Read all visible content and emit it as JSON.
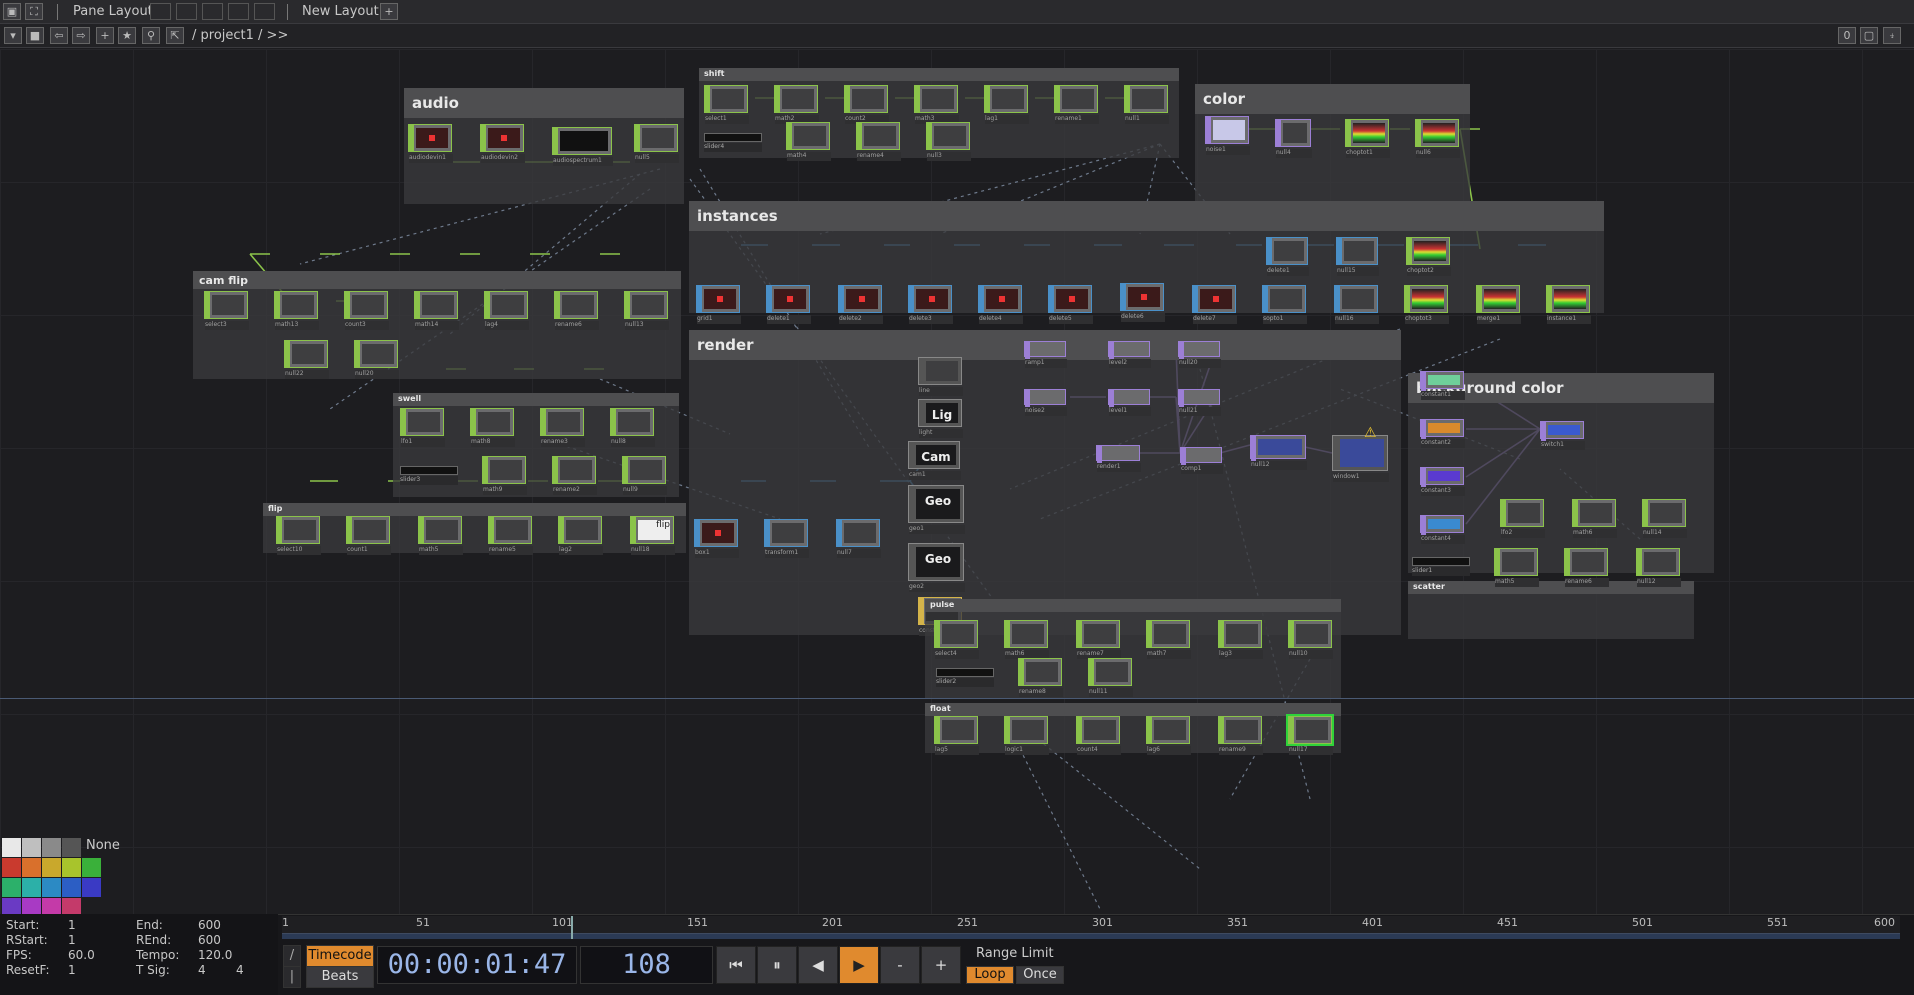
{
  "toolbar": {
    "pane_layout_label": "Pane Layout",
    "new_layout_label": "New Layout",
    "path": "/ project1 / >>",
    "right_badge": "0"
  },
  "components": {
    "audio": "audio",
    "shift": "shift",
    "color": "color",
    "instances": "instances",
    "cam_flip": "cam flip",
    "render": "render",
    "swell": "swell",
    "flip": "flip",
    "background_color": "background color",
    "scatter": "scatter",
    "pulse": "pulse",
    "float": "float"
  },
  "nodes": {
    "audio": [
      "audiodevin1",
      "audiodevin2",
      "audiospectrum1",
      "null5"
    ],
    "shift_row1": [
      "select1",
      "math2",
      "count2",
      "math3",
      "lag1",
      "rename1",
      "null1"
    ],
    "shift_row2": [
      "math4",
      "rename4",
      "null3"
    ],
    "shift_slider": "slider4",
    "color": [
      "noise1",
      "null4",
      "choptot1",
      "null6"
    ],
    "instances_top": [
      "delete1",
      "null15",
      "choptot2"
    ],
    "instances_row": [
      "grid1",
      "delete1",
      "delete2",
      "delete3",
      "delete4",
      "delete5",
      "delete6",
      "delete7",
      "sopto1",
      "null16",
      "choptot3",
      "merge1",
      "instance1"
    ],
    "cam_flip_row1": [
      "select3",
      "math13",
      "count3",
      "math14",
      "lag4",
      "rename6",
      "null13"
    ],
    "cam_flip_row2": [
      "null22",
      "null20"
    ],
    "render": [
      "line",
      "light",
      "cam1",
      "geo1",
      "geo2",
      "constant1",
      "ramp1",
      "noise2",
      "level2",
      "level1",
      "null20",
      "null21",
      "render1",
      "comp1",
      "null12",
      "window1"
    ],
    "render_labels": {
      "lig": "Lig",
      "cam": "Cam",
      "geo": "Geo"
    },
    "swell_row1": [
      "lfo1",
      "math8",
      "rename3",
      "null8"
    ],
    "swell_row2": [
      "math9",
      "rename2",
      "null9"
    ],
    "swell_slider": "slider3",
    "flip_row": [
      "select10",
      "count1",
      "math5",
      "rename5",
      "lag2",
      "null18"
    ],
    "flip_label": "flip",
    "flip_tops": [
      "box1",
      "transform1",
      "null7"
    ],
    "bg_color": [
      "constant1",
      "constant2",
      "constant3",
      "constant4",
      "switch1",
      "lfo2",
      "math6",
      "null14"
    ],
    "scatter": [
      "math5",
      "rename6",
      "null12"
    ],
    "scatter_slider": "slider1",
    "pulse_row1": [
      "select4",
      "math6",
      "rename7",
      "math7",
      "lag3",
      "null10"
    ],
    "pulse_row2": [
      "rename8",
      "null11"
    ],
    "pulse_slider": "slider2",
    "float_row": [
      "lag5",
      "logic1",
      "count4",
      "lag6",
      "rename9",
      "null17"
    ]
  },
  "palette": {
    "none_label": "None",
    "colors": [
      "#e8e8e8",
      "#bfbfbf",
      "#8a8a8a",
      "#555555",
      "#c93a2e",
      "#d9702c",
      "#c9a82c",
      "#a8c42c",
      "#3ab03a",
      "#2cb06a",
      "#2cb0a8",
      "#2c8ac4",
      "#2c5ec4",
      "#3a3ac4",
      "#6a3ac4",
      "#a83ac4",
      "#c43aa8",
      "#c43a6a"
    ]
  },
  "stats": {
    "start_label": "Start:",
    "start": "1",
    "end_label": "End:",
    "end": "600",
    "rstart_label": "RStart:",
    "rstart": "1",
    "rend_label": "REnd:",
    "rend": "600",
    "fps_label": "FPS:",
    "fps": "60.0",
    "tempo_label": "Tempo:",
    "tempo": "120.0",
    "resetf_label": "ResetF:",
    "resetf": "1",
    "tsig_label": "T Sig:",
    "tsig_a": "4",
    "tsig_b": "4"
  },
  "timeline": {
    "ticks": [
      "1",
      "51",
      "101",
      "151",
      "201",
      "251",
      "301",
      "351",
      "401",
      "451",
      "501",
      "551",
      "600"
    ],
    "timecode_btn": "Timecode",
    "beats_btn": "Beats",
    "timecode": "00:00:01:47",
    "frame": "108",
    "range_limit_label": "Range Limit",
    "loop_btn": "Loop",
    "once_btn": "Once",
    "transport": {
      "rewind": "⏮",
      "pause": "⏸",
      "step_back": "◀",
      "play": "▶",
      "minus": "-",
      "plus": "+"
    }
  }
}
